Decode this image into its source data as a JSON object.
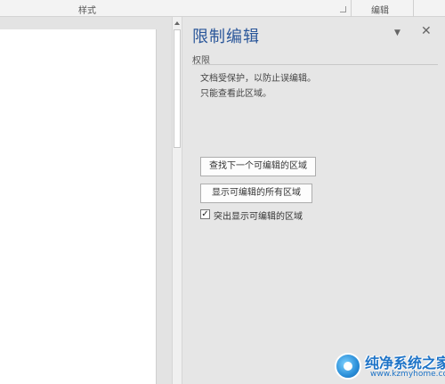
{
  "ribbon": {
    "styles_group_label": "样式",
    "editing_group_label": "编辑"
  },
  "pane": {
    "title": "限制编辑",
    "menu_icon": "dropdown-arrow-icon",
    "close_icon": "close-icon",
    "section_label": "权限",
    "description_line1": "文档受保护，以防止误编辑。",
    "description_line2": "只能查看此区域。",
    "find_next_button": "查找下一个可编辑的区域",
    "show_all_button": "显示可编辑的所有区域",
    "highlight_checkbox_label": "突出显示可编辑的区域",
    "highlight_checked": true
  },
  "watermark": {
    "title": "纯净系统之家",
    "url": "www.kzmyhome.com"
  },
  "colors": {
    "title_blue": "#2b579a",
    "pane_bg": "#e6e6e6",
    "watermark_blue": "#1d73c7"
  }
}
